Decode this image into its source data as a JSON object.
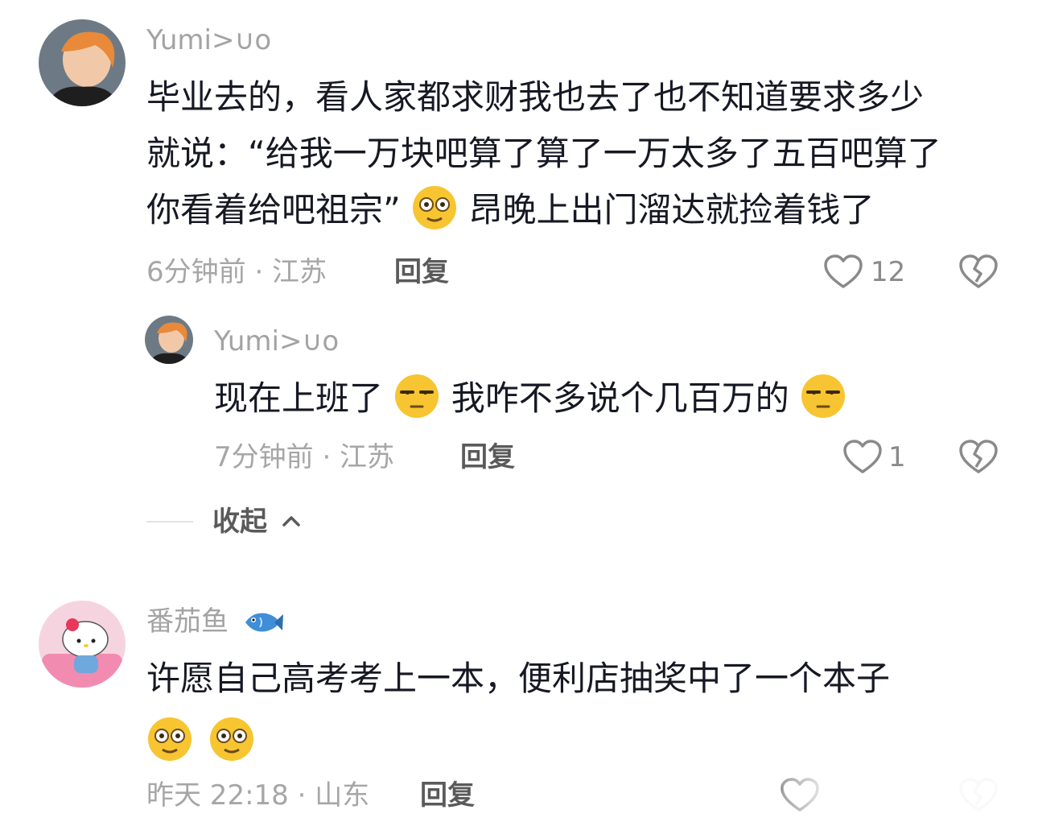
{
  "comments": [
    {
      "user": "Yumi>∪o",
      "text_lines": [
        "毕业去的，看人家都求财我也去了也不知道要求多少",
        "就说：“给我一万块吧算了算了一万太多了五百吧算了",
        "你看着给吧祖宗”",
        "昂晚上出门溜达就捡着钱了"
      ],
      "meta": "6分钟前 · 江苏",
      "reply_label": "回复",
      "likes": "12"
    },
    {
      "user": "Yumi>∪o",
      "text_parts": [
        "现在上班了",
        "我咋不多说个几百万的"
      ],
      "meta": "7分钟前 · 江苏",
      "reply_label": "回复",
      "likes": "1"
    },
    {
      "user": "番茄鱼",
      "text_lines": [
        "许愿自己高考考上一本，便利店抽奖中了一个本子"
      ],
      "meta": "昨天 22:18 · 山东",
      "reply_label": "回复"
    }
  ],
  "collapse_label": "收起",
  "colors": {
    "text": "#161823",
    "muted": "#a6a6a6",
    "emoji": "#f7c531"
  }
}
